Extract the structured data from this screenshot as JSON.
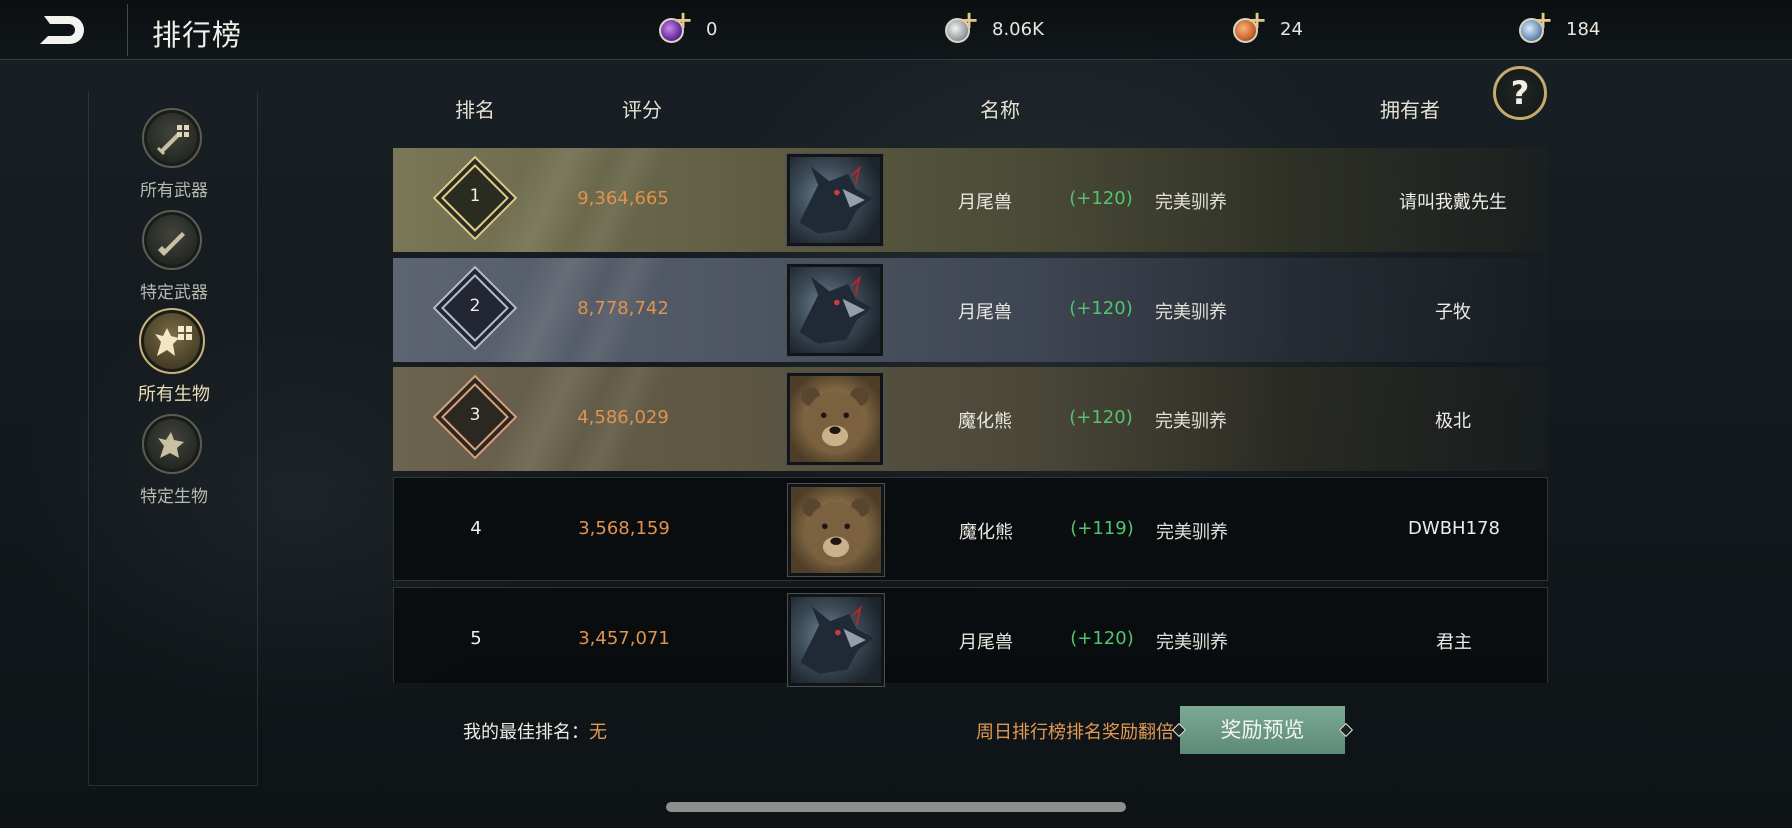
{
  "header": {
    "title": "排行榜",
    "back_icon": "back-arrow-icon",
    "currencies": [
      {
        "icon": "purple-orb-icon",
        "color": "#7b3fb0",
        "value": "0"
      },
      {
        "icon": "silver-orb-icon",
        "color": "#9aa0a6",
        "value": "8.06K"
      },
      {
        "icon": "orange-orb-icon",
        "color": "#c9632b",
        "value": "24"
      },
      {
        "icon": "blue-orb-icon",
        "color": "#6d8fb3",
        "value": "184"
      }
    ]
  },
  "sidebar": {
    "items": [
      {
        "label": "所有武器",
        "icon": "sword-grid-icon",
        "active": false
      },
      {
        "label": "特定武器",
        "icon": "sword-icon",
        "active": false
      },
      {
        "label": "所有生物",
        "icon": "creature-grid-icon",
        "active": true
      },
      {
        "label": "特定生物",
        "icon": "creature-icon",
        "active": false
      }
    ]
  },
  "table": {
    "headers": {
      "rank": "排名",
      "score": "评分",
      "name": "名称",
      "owner": "拥有者"
    },
    "rows": [
      {
        "rank": "1",
        "score": "9,364,665",
        "portrait": "wolf-portrait-icon",
        "name": "月尾兽",
        "bonus": "(+120)",
        "tame": "完美驯养",
        "owner": "请叫我戴先生"
      },
      {
        "rank": "2",
        "score": "8,778,742",
        "portrait": "wolf-portrait-icon",
        "name": "月尾兽",
        "bonus": "(+120)",
        "tame": "完美驯养",
        "owner": "子牧"
      },
      {
        "rank": "3",
        "score": "4,586,029",
        "portrait": "bear-portrait-icon",
        "name": "魔化熊",
        "bonus": "(+120)",
        "tame": "完美驯养",
        "owner": "极北"
      },
      {
        "rank": "4",
        "score": "3,568,159",
        "portrait": "bear-portrait-icon",
        "name": "魔化熊",
        "bonus": "(+119)",
        "tame": "完美驯养",
        "owner": "DWBH178"
      },
      {
        "rank": "5",
        "score": "3,457,071",
        "portrait": "wolf-portrait-icon",
        "name": "月尾兽",
        "bonus": "(+120)",
        "tame": "完美驯养",
        "owner": "君主"
      }
    ]
  },
  "help": {
    "label": "?",
    "icon": "help-icon"
  },
  "footer": {
    "my_best_rank_label": "我的最佳排名：",
    "my_best_rank_value": "无",
    "reward_note": "周日排行榜排名奖励翻倍",
    "reward_button": "奖励预览"
  },
  "colors": {
    "score": "#e0934e",
    "bonus": "#53c46e",
    "gold_accent": "#c9b27a",
    "reward_button": "#6f9c8a"
  }
}
